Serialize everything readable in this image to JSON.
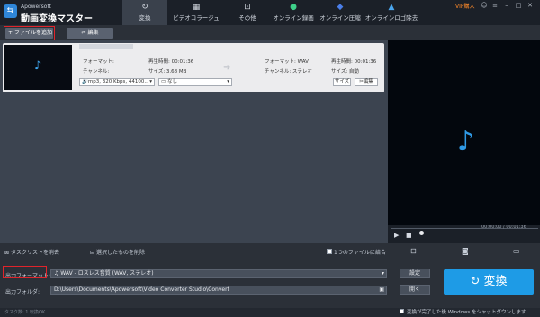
{
  "app": {
    "brand": "Apowersoft",
    "title": "動画変換マスター",
    "vip": "VIP購入"
  },
  "tabs": [
    {
      "label": "変換",
      "icon": "refresh-icon"
    },
    {
      "label": "ビデオコラージュ",
      "icon": "collage-icon"
    },
    {
      "label": "その他",
      "icon": "toolbox-icon"
    },
    {
      "label": "オンライン録画",
      "icon": "record-icon"
    },
    {
      "label": "オンライン圧縮",
      "icon": "compress-icon"
    },
    {
      "label": "オンラインロゴ除去",
      "icon": "logo-remove-icon"
    }
  ],
  "toolbar": {
    "add_file": "ファイルを追加",
    "edit": "編集"
  },
  "file": {
    "format_label": "フォーマット:",
    "format_value": "",
    "channel_label": "チャンネル:",
    "channel_value": "",
    "duration": "再生時間: 00:01:36",
    "size": "サイズ: 3.68 MB",
    "out_format": "フォーマット: WAV",
    "out_channel": "チャンネル: ステレオ",
    "out_duration": "再生時間: 00:01:36",
    "out_size": "サイズ: 自動",
    "audio_select": "mp3, 320 Kbps, 44100...",
    "subtitle_select": "なし",
    "size_btn": "サイズ",
    "edit_btn": "編集"
  },
  "player": {
    "time": "00:00:00 / 00:01:36"
  },
  "actions": {
    "clear_tasks": "タスクリストを消去",
    "delete_selected": "選択したものを削除",
    "merge": "1つのファイルに結合"
  },
  "output": {
    "format_label": "出力フォーマット:",
    "format_value": "WAV - ロスレス音質 (WAV, ステレオ)",
    "folder_label": "出力フォルダ:",
    "folder_value": "D:\\Users\\Documents\\Apowersoft\\Video Converter Studio\\Convert",
    "settings_btn": "設定",
    "open_btn": "開く",
    "convert_btn": "変換"
  },
  "status": {
    "left": "タスク数: 1    転換OK",
    "shutdown": "変換が完了した後 Windows をシャットダウンします"
  },
  "colors": {
    "accent": "#1e9be6",
    "highlight": "#e0242b",
    "vip": "#ff8a2a"
  }
}
